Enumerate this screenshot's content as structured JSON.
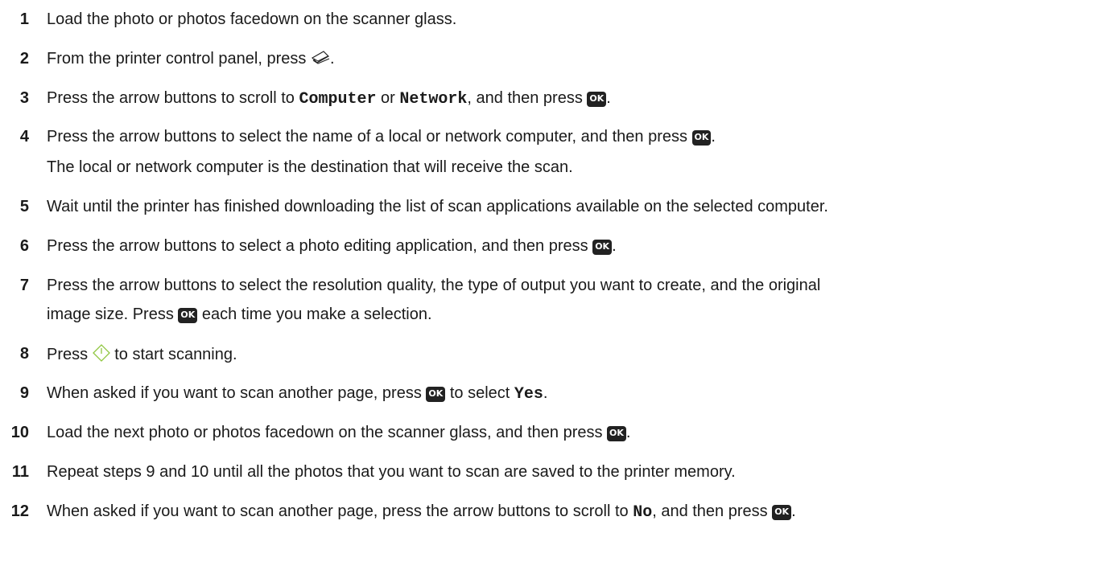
{
  "steps": [
    {
      "num": "1",
      "text": "Load the photo or photos facedown on the scanner glass."
    },
    {
      "num": "2",
      "before": "From the printer control panel, press",
      "after": "."
    },
    {
      "num": "3",
      "t1": "Press the arrow buttons to scroll to ",
      "code1": "Computer",
      "t2": " or ",
      "code2": "Network",
      "t3": ", and then press",
      "t4": "."
    },
    {
      "num": "4",
      "t1": "Press the arrow buttons to select the name of a local or network computer, and then press",
      "t2": ".",
      "note": "The local or network computer is the destination that will receive the scan."
    },
    {
      "num": "5",
      "text": "Wait until the printer has finished downloading the list of scan applications available on the selected computer."
    },
    {
      "num": "6",
      "t1": "Press the arrow buttons to select a photo editing application, and then press",
      "t2": "."
    },
    {
      "num": "7",
      "line1": "Press the arrow buttons to select the resolution quality, the type of output you want to create, and the original",
      "t1": "image size. Press",
      "t2": "each time you make a selection."
    },
    {
      "num": "8",
      "t1": "Press",
      "t2": "to start scanning."
    },
    {
      "num": "9",
      "t1": "When asked if you want to scan another page, press",
      "t2": "to select ",
      "code": "Yes",
      "t3": "."
    },
    {
      "num": "10",
      "t1": "Load the next photo or photos facedown on the scanner glass, and then press",
      "t2": "."
    },
    {
      "num": "11",
      "text": "Repeat steps 9 and 10 until all the photos that you want to scan are saved to the printer memory."
    },
    {
      "num": "12",
      "t1": "When asked if you want to scan another page, press the arrow buttons to scroll to ",
      "code": "No",
      "t2": ", and then press",
      "t3": "."
    }
  ],
  "ok_label": "OK",
  "icons": {
    "scan": "scan-icon",
    "start": "start-icon",
    "ok": "ok-button-icon"
  }
}
